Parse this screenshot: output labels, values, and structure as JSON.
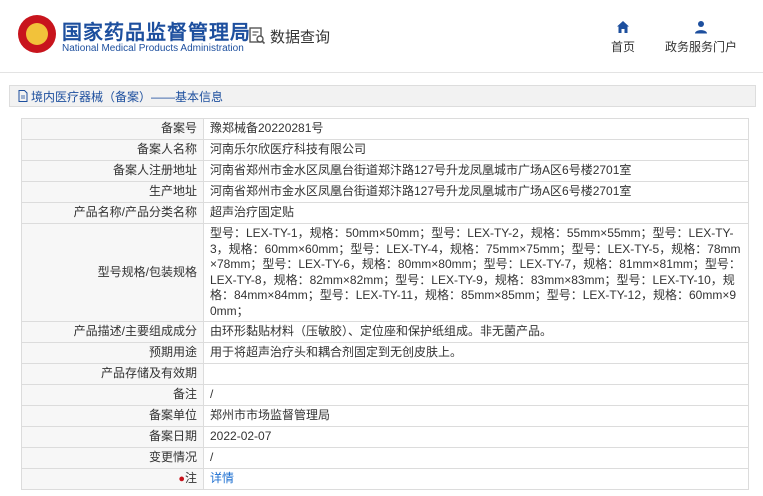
{
  "header": {
    "brand_cn": "国家药品监督管理局",
    "brand_en": "National Medical Products Administration",
    "query_label": "数据查询",
    "nav": {
      "home": "首页",
      "portal": "政务服务门户"
    }
  },
  "section": {
    "title": "境内医疗器械（备案）——基本信息"
  },
  "rows": [
    {
      "label": "备案号",
      "value": "豫郑械备20220281号"
    },
    {
      "label": "备案人名称",
      "value": "河南乐尔欣医疗科技有限公司"
    },
    {
      "label": "备案人注册地址",
      "value": "河南省郑州市金水区凤凰台街道郑汴路127号升龙凤凰城市广场A区6号楼2701室"
    },
    {
      "label": "生产地址",
      "value": "河南省郑州市金水区凤凰台街道郑汴路127号升龙凤凰城市广场A区6号楼2701室"
    },
    {
      "label": "产品名称/产品分类名称",
      "value": "超声治疗固定贴"
    },
    {
      "label": "型号规格/包装规格",
      "value": "型号：LEX-TY-1，规格：50mm×50mm；型号：LEX-TY-2，规格：55mm×55mm；型号：LEX-TY-3，规格：60mm×60mm；型号：LEX-TY-4，规格：75mm×75mm；型号：LEX-TY-5，规格：78mm×78mm；型号：LEX-TY-6，规格：80mm×80mm；型号：LEX-TY-7，规格：81mm×81mm；型号：LEX-TY-8，规格：82mm×82mm；型号：LEX-TY-9，规格：83mm×83mm；型号：LEX-TY-10，规格：84mm×84mm；型号：LEX-TY-11，规格：85mm×85mm；型号：LEX-TY-12，规格：60mm×90mm；"
    },
    {
      "label": "产品描述/主要组成成分",
      "value": "由环形黏贴材料（压敏胶）、定位座和保护纸组成。非无菌产品。"
    },
    {
      "label": "预期用途",
      "value": "用于将超声治疗头和耦合剂固定到无创皮肤上。"
    },
    {
      "label": "产品存储及有效期",
      "value": ""
    },
    {
      "label": "备注",
      "value": "/"
    },
    {
      "label": "备案单位",
      "value": "郑州市市场监督管理局"
    },
    {
      "label": "备案日期",
      "value": "2022-02-07"
    },
    {
      "label": "变更情况",
      "value": "/"
    },
    {
      "label": "注",
      "value": "详情"
    }
  ],
  "colors": {
    "brand_blue": "#1d4f9e",
    "logo_red": "#c8141d",
    "link_blue": "#1d6fd1"
  }
}
